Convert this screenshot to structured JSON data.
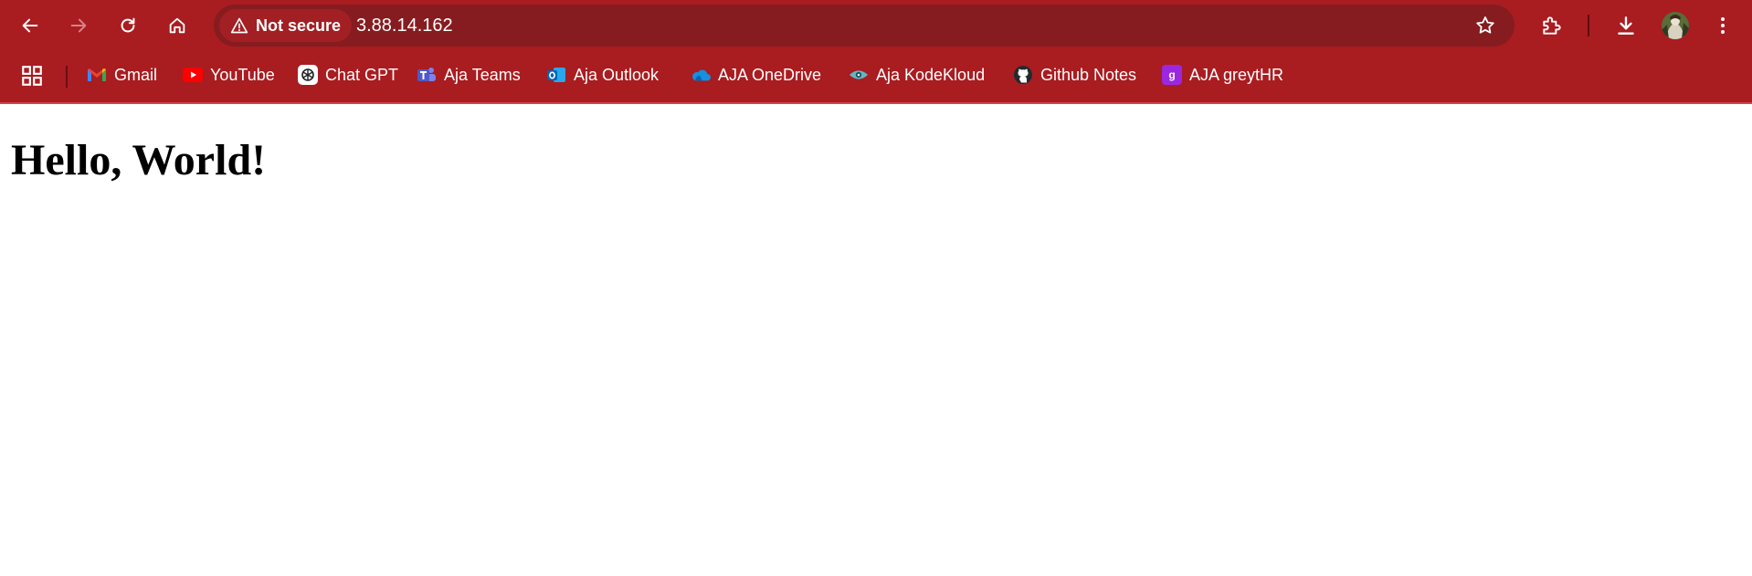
{
  "browser": {
    "theme_color": "#a91c20",
    "omnibox_color": "#861c1f",
    "security_chip": {
      "label": "Not secure",
      "icon": "warning-triangle-icon"
    },
    "url": "3.88.14.162",
    "toolbar_icons": [
      "back-icon",
      "forward-icon",
      "reload-icon",
      "home-icon",
      "bookmark-star-icon",
      "extensions-icon",
      "download-icon",
      "avatar",
      "more-menu-icon"
    ]
  },
  "bookmarks": [
    {
      "label": "Gmail",
      "icon": "gmail-icon"
    },
    {
      "label": "YouTube",
      "icon": "youtube-icon"
    },
    {
      "label": "Chat GPT",
      "icon": "chatgpt-icon"
    },
    {
      "label": "Aja Teams",
      "icon": "teams-icon"
    },
    {
      "label": "Aja Outlook",
      "icon": "outlook-icon"
    },
    {
      "label": "AJA OneDrive",
      "icon": "onedrive-icon"
    },
    {
      "label": "Aja KodeKloud",
      "icon": "kodekloud-icon"
    },
    {
      "label": "Github Notes",
      "icon": "github-icon"
    },
    {
      "label": "AJA greytHR",
      "icon": "greythr-icon"
    }
  ],
  "page": {
    "heading": "Hello, World!"
  }
}
